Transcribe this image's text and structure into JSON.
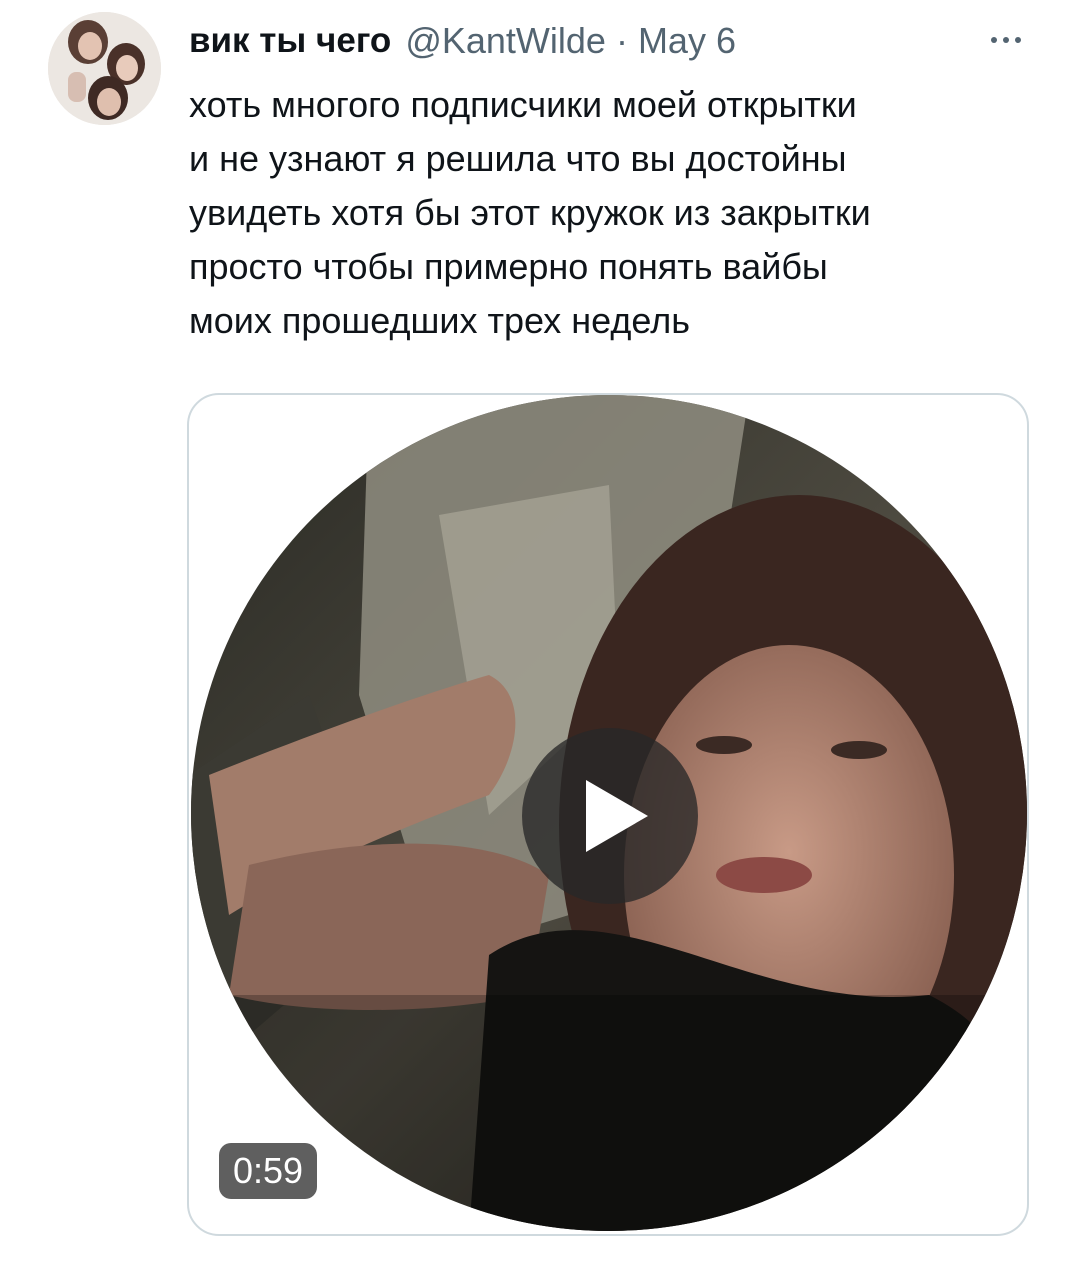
{
  "tweet": {
    "author": {
      "display_name": "вик ты чего",
      "handle": "@KantWilde",
      "avatar_icon": "profile-photo-avatar"
    },
    "separator": "·",
    "date": "May 6",
    "more_icon": "ellipsis-horizontal-icon",
    "text_lines": [
      "хоть многого подписчики моей открытки",
      "и не узнают я решила что вы достойны",
      "увидеть хотя бы этот кружок из закрытки",
      "просто чтобы примерно понять вайбы",
      "моих прошедших трех недель"
    ],
    "media": {
      "type": "video",
      "shape": "round-video-note",
      "play_icon": "play-icon",
      "duration": "0:59"
    }
  },
  "colors": {
    "text_primary": "#0f1419",
    "text_secondary": "#536471",
    "border": "#cfd9de",
    "background": "#ffffff"
  }
}
